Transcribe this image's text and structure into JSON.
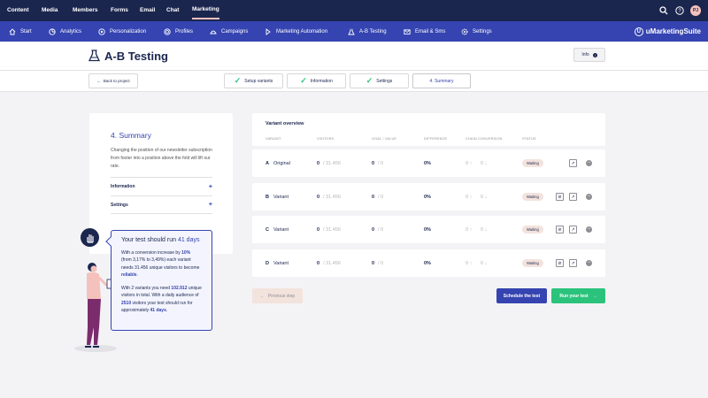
{
  "topnav": {
    "items": [
      {
        "label": "Content"
      },
      {
        "label": "Media"
      },
      {
        "label": "Members"
      },
      {
        "label": "Forms"
      },
      {
        "label": "Email"
      },
      {
        "label": "Chat"
      },
      {
        "label": "Marketing"
      }
    ],
    "active": "Marketing",
    "user_initials": "PJ",
    "icons": [
      "search-icon",
      "help-icon"
    ]
  },
  "subnav": {
    "items": [
      {
        "label": "Start",
        "icon": "home-icon"
      },
      {
        "label": "Analytics",
        "icon": "analytics-icon"
      },
      {
        "label": "Personalization",
        "icon": "personalization-icon"
      },
      {
        "label": "Profiles",
        "icon": "profiles-icon"
      },
      {
        "label": "Campaigns",
        "icon": "campaigns-icon"
      },
      {
        "label": "Marketing Automation",
        "icon": "automation-icon"
      },
      {
        "label": "A-B Testing",
        "icon": "flask-icon"
      },
      {
        "label": "Email & Sms",
        "icon": "email-icon"
      },
      {
        "label": "Settings",
        "icon": "gear-icon"
      }
    ],
    "brand": "uMarketingSuite"
  },
  "header": {
    "title": "A-B Testing",
    "info_label": "Info"
  },
  "steps": {
    "back_label": "Back to project",
    "items": [
      {
        "label": "Setup variants",
        "done": true
      },
      {
        "label": "Information",
        "done": true
      },
      {
        "label": "Settings",
        "done": true
      },
      {
        "label": "4. Summary",
        "done": false
      }
    ]
  },
  "summary": {
    "title": "4. Summary",
    "description": "Changing the position of our newsletter subscription from footer into a position above the fold will lift our rate.",
    "accordions": [
      {
        "label": "Information"
      },
      {
        "label": "Settings"
      }
    ]
  },
  "tip": {
    "title_prefix": "Your test should run ",
    "title_days": "41 days",
    "p1": {
      "t1": "With a conversion increase by ",
      "b1": "10%",
      "t2": " (from 3,17% to 3,49%) each variant needs 31.456 unique visitors to become ",
      "b2": "reliable",
      "t3": "."
    },
    "p2": {
      "t1": "With 2 variants you need ",
      "b1": "102.912",
      "t2": " unique visitors in total. With a daily audience of ",
      "b2": "2510",
      "t3": " visitors your test should run for approximately ",
      "b3": "41 days",
      "t4": "."
    }
  },
  "overview": {
    "title": "Variant overview",
    "columns": [
      "VARIANT",
      "VISITORS",
      "GOAL / VALUE",
      "DIFFERENCE",
      "CHAIN CONVERSION",
      "STATUS"
    ],
    "rows": [
      {
        "letter": "A",
        "name": "Original",
        "visitors": "0",
        "visitors_total": "/ 31.456",
        "goal": "0",
        "goal_total": "/ 0",
        "difference": "0%",
        "chain_up": "0 ↑",
        "chain_down": "0 ↓",
        "status": "Waiting",
        "hide_icon": false
      },
      {
        "letter": "B",
        "name": "Variant",
        "visitors": "0",
        "visitors_total": "/ 31.456",
        "goal": "0",
        "goal_total": "/ 0",
        "difference": "0%",
        "chain_up": "0 ↑",
        "chain_down": "0 ↓",
        "status": "Waiting",
        "hide_icon": true
      },
      {
        "letter": "C",
        "name": "Variant",
        "visitors": "0",
        "visitors_total": "/ 31.456",
        "goal": "0",
        "goal_total": "/ 0",
        "difference": "0%",
        "chain_up": "0 ↑",
        "chain_down": "0 ↓",
        "status": "Waiting",
        "hide_icon": true
      },
      {
        "letter": "D",
        "name": "Variant",
        "visitors": "0",
        "visitors_total": "/ 31.456",
        "goal": "0",
        "goal_total": "/ 0",
        "difference": "0%",
        "chain_up": "0 ↑",
        "chain_down": "0 ↓",
        "status": "Waiting",
        "hide_icon": true
      }
    ]
  },
  "actions": {
    "previous_label": "Previous step",
    "schedule_label": "Schedule the test",
    "run_label": "Run your test"
  },
  "colors": {
    "navy": "#1b264f",
    "accent_blue": "#3544b1",
    "green": "#2bc37c",
    "pink": "#f5c1bc",
    "beige": "#f3e3dd"
  }
}
